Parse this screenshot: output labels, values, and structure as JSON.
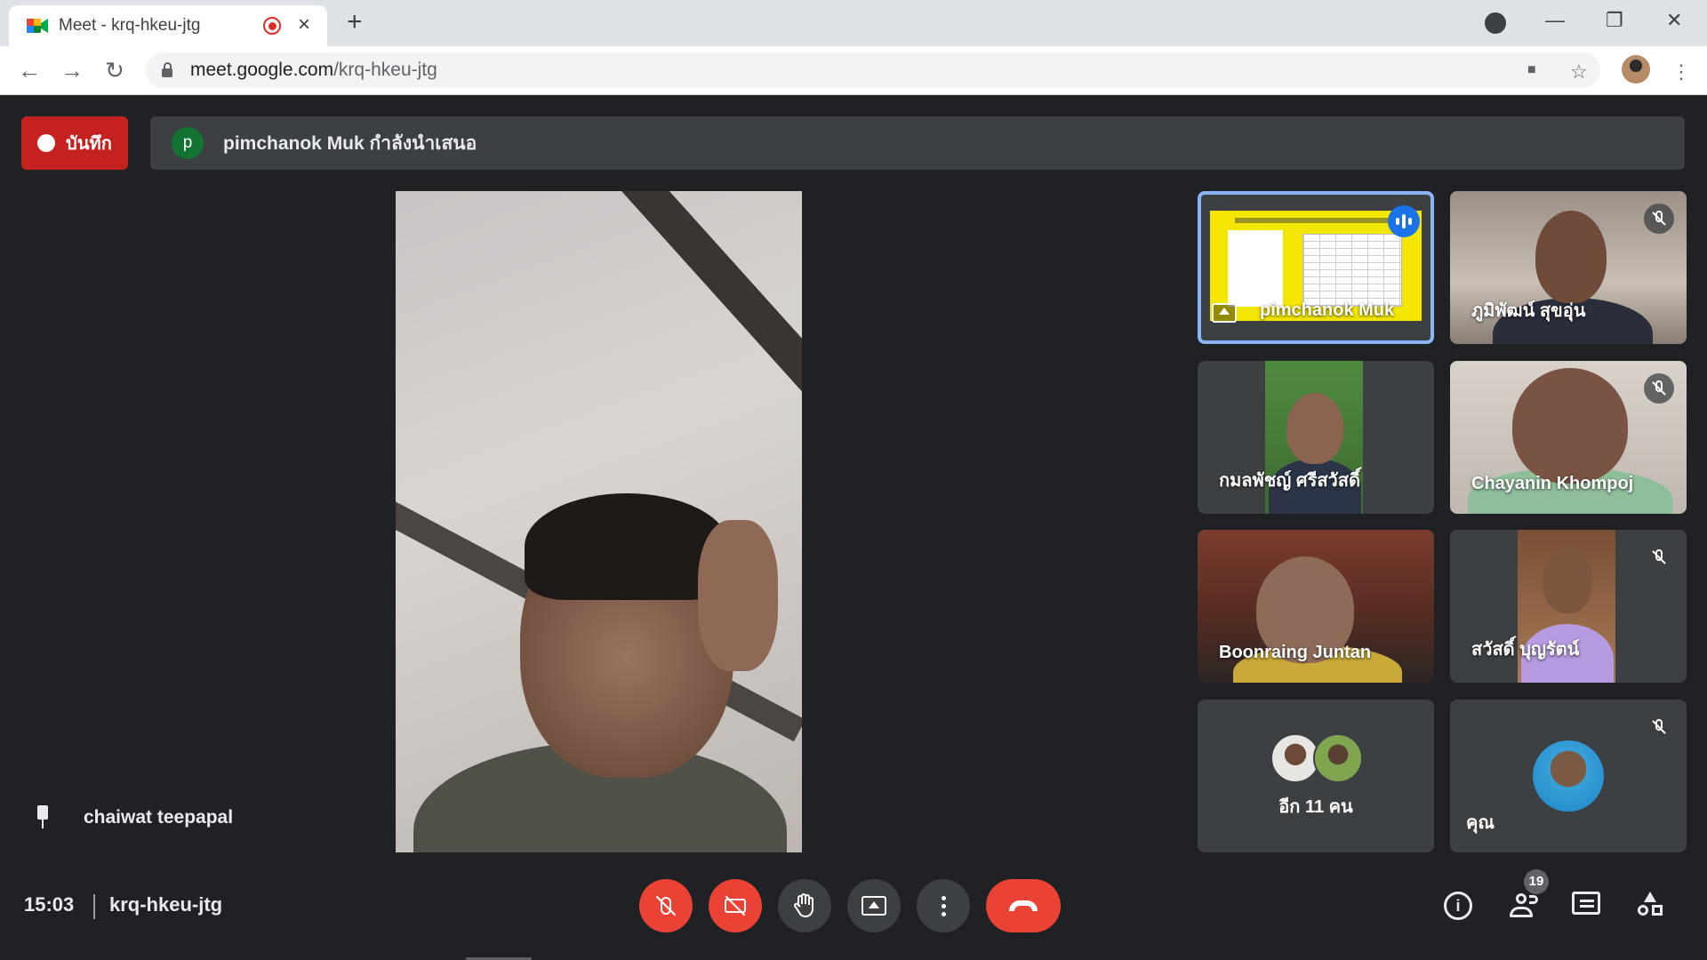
{
  "browser": {
    "tab_title": "Meet - krq-hkeu-jtg",
    "url_host": "meet.google.com",
    "url_path": "/krq-hkeu-jtg",
    "new_tab": "+",
    "tab_close": "×",
    "win_min": "—",
    "win_max": "❐",
    "win_close": "✕",
    "back": "←",
    "forward": "→",
    "reload": "↻",
    "star": "☆",
    "camera": "■",
    "menu": "⋮"
  },
  "top": {
    "record_label": "บันทึก",
    "presenter_initial": "p",
    "presenting_text": "pimchanok Muk กำลังนำเสนอ"
  },
  "main": {
    "pinned_name": "chaiwat teepapal"
  },
  "tiles": [
    {
      "name": "pimchanok Muk",
      "state": "presenting-speaking"
    },
    {
      "name": "ภูมิพัฒน์ สุขอุ่น",
      "state": "muted"
    },
    {
      "name": "กมลพัชญ์ ศรีสวัสดิ์",
      "state": ""
    },
    {
      "name": "Chayanin Khompoj",
      "state": "muted"
    },
    {
      "name": "Boonraing Juntan",
      "state": ""
    },
    {
      "name": "สวัสดิ์ บุญรัตน์",
      "state": "muted"
    },
    {
      "name": "อีก 11 คน",
      "state": "more"
    },
    {
      "name": "คุณ",
      "state": "muted"
    }
  ],
  "bottom": {
    "time": "15:03",
    "meeting_code": "krq-hkeu-jtg",
    "participants_count": "19",
    "info": "i",
    "more": "⋮"
  },
  "colors": {
    "background": "#202124",
    "panel": "#3c4043",
    "danger": "#ea4335",
    "record": "#c5221f",
    "accent_blue": "#1a73e8",
    "presenter_avatar": "#137333"
  }
}
